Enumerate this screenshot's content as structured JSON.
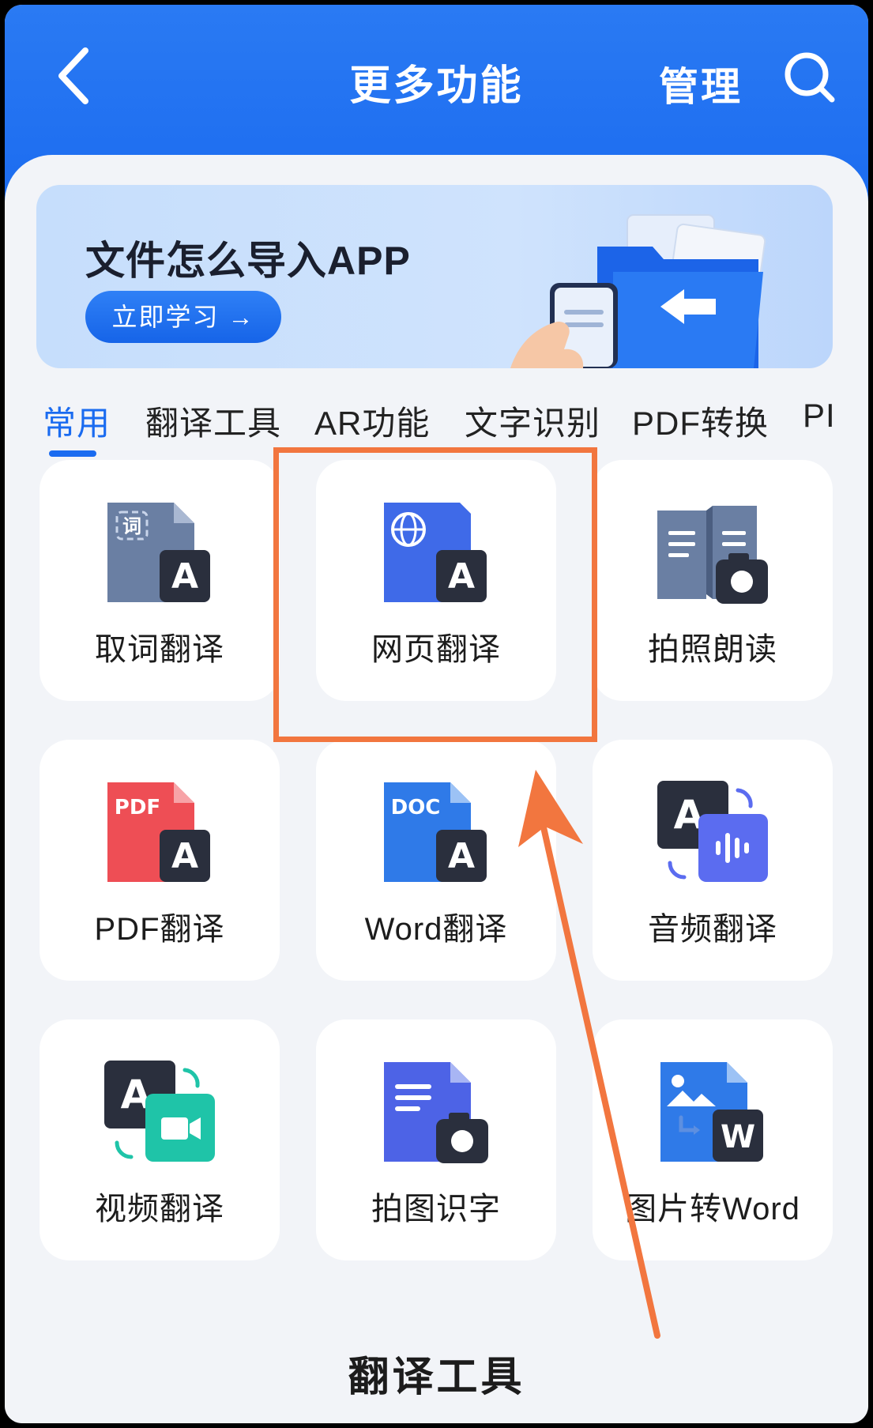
{
  "header": {
    "title": "更多功能",
    "manage_label": "管理"
  },
  "banner": {
    "title": "文件怎么导入APP",
    "button_label": "立即学习 →"
  },
  "tabs": [
    {
      "label": "常用",
      "active": true
    },
    {
      "label": "翻译工具"
    },
    {
      "label": "AR功能"
    },
    {
      "label": "文字识别"
    },
    {
      "label": "PDF转换"
    },
    {
      "label": "PI"
    }
  ],
  "features": [
    {
      "label": "取词翻译",
      "icon": "word-pick-translate-icon",
      "icon_text": "词"
    },
    {
      "label": "网页翻译",
      "icon": "web-translate-icon",
      "highlighted": true
    },
    {
      "label": "拍照朗读",
      "icon": "photo-read-aloud-icon"
    },
    {
      "label": "PDF翻译",
      "icon": "pdf-translate-icon",
      "icon_text": "PDF"
    },
    {
      "label": "Word翻译",
      "icon": "word-translate-icon",
      "icon_text": "DOC"
    },
    {
      "label": "音频翻译",
      "icon": "audio-translate-icon"
    },
    {
      "label": "视频翻译",
      "icon": "video-translate-icon"
    },
    {
      "label": "拍图识字",
      "icon": "photo-ocr-icon"
    },
    {
      "label": "图片转Word",
      "icon": "image-to-word-icon",
      "icon_text": "W"
    }
  ],
  "footer": {
    "title": "翻译工具"
  },
  "colors": {
    "primary": "#1a6bf0",
    "annotation": "#f2763f",
    "background": "#f2f4f8"
  }
}
